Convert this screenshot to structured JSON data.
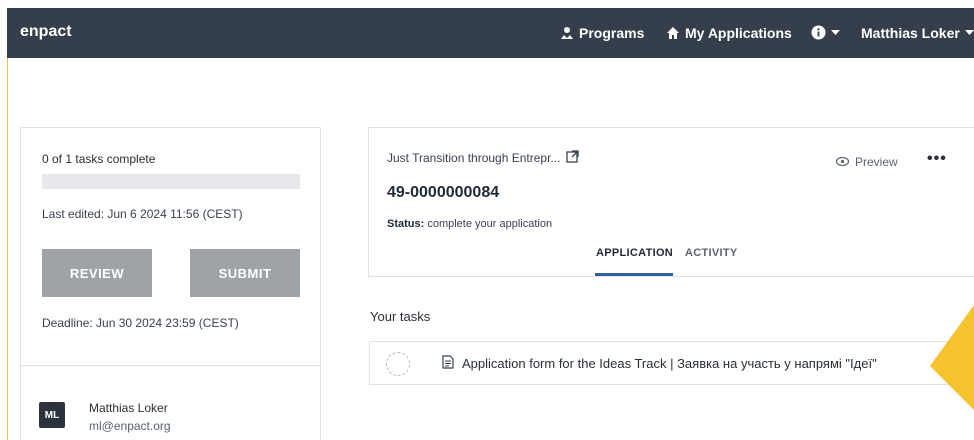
{
  "nav": {
    "brand": "enpact",
    "programs": "Programs",
    "my_applications": "My Applications",
    "user": "Matthias Loker"
  },
  "left": {
    "tasks_complete": "0 of 1 tasks complete",
    "progress": 0,
    "last_edited": "Last edited: Jun 6 2024 11:56 (CEST)",
    "review": "REVIEW",
    "submit": "SUBMIT",
    "deadline": "Deadline: Jun 30 2024 23:59 (CEST)",
    "avatar": "ML",
    "user_name": "Matthias Loker",
    "user_email": "ml@enpact.org"
  },
  "app": {
    "program": "Just Transition through Entrepr...",
    "preview": "Preview",
    "more": "•••",
    "id": "49-0000000084",
    "status_label": "Status:",
    "status_value": "complete your application",
    "tab_application": "APPLICATION",
    "tab_activity": "ACTIVITY"
  },
  "tasks": {
    "title": "Your tasks",
    "items": [
      {
        "label": "Application form for the Ideas Track | Заявка на участь у напрямі \"Ідеї\""
      }
    ]
  },
  "colors": {
    "navbar": "#353f4b",
    "button": "#9ea3a8",
    "accent": "#2e5f9e",
    "yellow": "#f7c22e"
  }
}
